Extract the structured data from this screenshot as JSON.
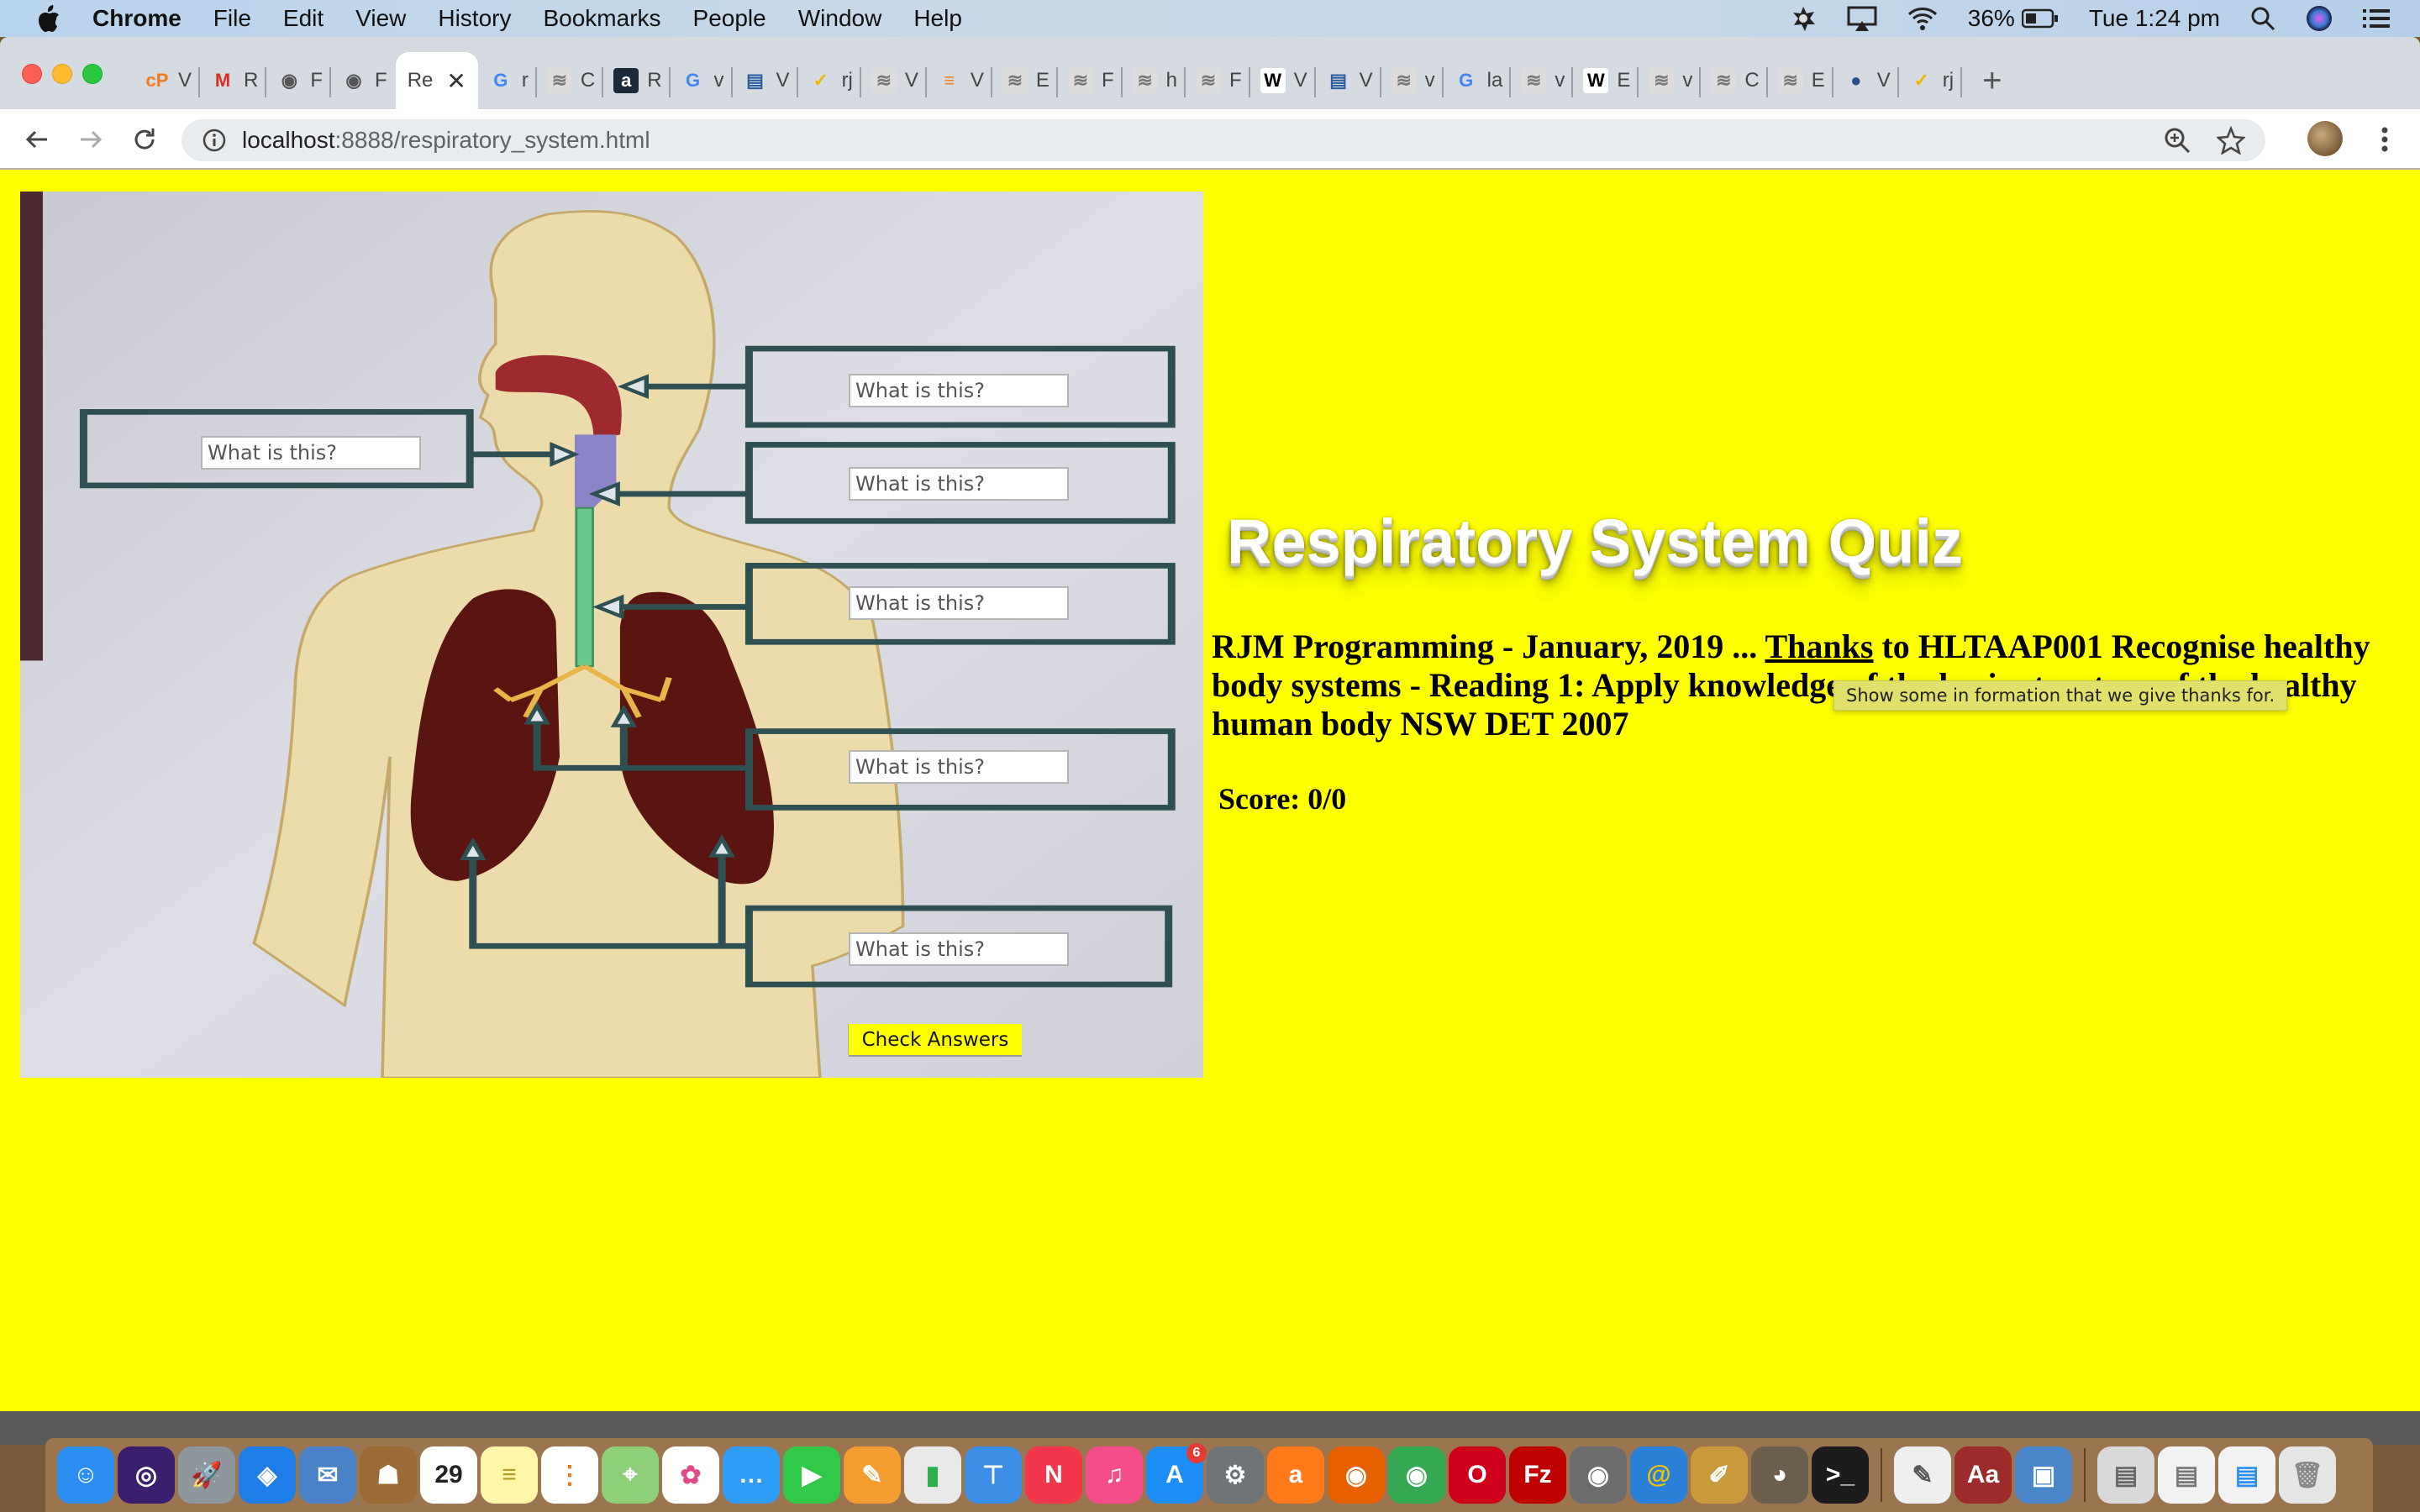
{
  "menubar": {
    "app_name": "Chrome",
    "items": [
      "File",
      "Edit",
      "View",
      "History",
      "Bookmarks",
      "People",
      "Window",
      "Help"
    ],
    "battery": "36%",
    "clock": "Tue 1:24 pm"
  },
  "tabs": [
    {
      "icon": "cpanel-icon",
      "glyph": "cP",
      "label": "V",
      "color": "#f07c1c",
      "bg": "transparent"
    },
    {
      "icon": "gmail-icon",
      "glyph": "M",
      "label": "R",
      "color": "#d93025",
      "bg": "transparent"
    },
    {
      "icon": "mamp-elephant-icon",
      "glyph": "◉",
      "label": "F",
      "color": "#555555",
      "bg": "transparent"
    },
    {
      "icon": "mamp-elephant-icon",
      "glyph": "◉",
      "label": "F",
      "color": "#555555",
      "bg": "transparent"
    },
    {
      "icon": "none",
      "glyph": "",
      "label": "Re",
      "active": true
    },
    {
      "icon": "google-icon",
      "glyph": "G",
      "label": "r",
      "color": "#4285f4",
      "bg": "transparent"
    },
    {
      "icon": "rjm-logo-icon",
      "glyph": "≋",
      "label": "C",
      "color": "#777777",
      "bg": "#dddddd"
    },
    {
      "icon": "amazon-icon",
      "glyph": "a",
      "label": "R",
      "color": "#ffffff",
      "bg": "#1b2a3a"
    },
    {
      "icon": "google-icon",
      "glyph": "G",
      "label": "v",
      "color": "#4285f4",
      "bg": "transparent"
    },
    {
      "icon": "document-icon",
      "glyph": "▤",
      "label": "V",
      "color": "#2a5d9f",
      "bg": "transparent"
    },
    {
      "icon": "norton-check-icon",
      "glyph": "✓",
      "label": "rj",
      "color": "#f2b600",
      "bg": "transparent"
    },
    {
      "icon": "rjm-logo-icon",
      "glyph": "≋",
      "label": "V",
      "color": "#777777",
      "bg": "#dddddd"
    },
    {
      "icon": "stackoverflow-icon",
      "glyph": "≡",
      "label": "V",
      "color": "#f48024",
      "bg": "transparent"
    },
    {
      "icon": "rjm-logo-icon",
      "glyph": "≋",
      "label": "E",
      "color": "#777777",
      "bg": "#dddddd"
    },
    {
      "icon": "rjm-logo-icon",
      "glyph": "≋",
      "label": "F",
      "color": "#777777",
      "bg": "#dddddd"
    },
    {
      "icon": "rjm-logo-icon",
      "glyph": "≋",
      "label": "h",
      "color": "#777777",
      "bg": "#dddddd"
    },
    {
      "icon": "rjm-logo-icon",
      "glyph": "≋",
      "label": "F",
      "color": "#777777",
      "bg": "#dddddd"
    },
    {
      "icon": "wikipedia-icon",
      "glyph": "W",
      "label": "V",
      "color": "#000000",
      "bg": "#ffffff"
    },
    {
      "icon": "document-icon",
      "glyph": "▤",
      "label": "V",
      "color": "#2a5d9f",
      "bg": "transparent"
    },
    {
      "icon": "rjm-logo-icon",
      "glyph": "≋",
      "label": "v",
      "color": "#777777",
      "bg": "#dddddd"
    },
    {
      "icon": "google-icon",
      "glyph": "G",
      "label": "la",
      "color": "#4285f4",
      "bg": "transparent"
    },
    {
      "icon": "rjm-logo-icon",
      "glyph": "≋",
      "label": "v",
      "color": "#777777",
      "bg": "#dddddd"
    },
    {
      "icon": "wikipedia-icon",
      "glyph": "W",
      "label": "E",
      "color": "#000000",
      "bg": "#ffffff"
    },
    {
      "icon": "rjm-logo-icon",
      "glyph": "≋",
      "label": "v",
      "color": "#777777",
      "bg": "#dddddd"
    },
    {
      "icon": "rjm-logo-icon",
      "glyph": "≋",
      "label": "C",
      "color": "#777777",
      "bg": "#dddddd"
    },
    {
      "icon": "rjm-logo-icon",
      "glyph": "≋",
      "label": "E",
      "color": "#777777",
      "bg": "#dddddd"
    },
    {
      "icon": "blue-orange-circle-icon",
      "glyph": "●",
      "label": "V",
      "color": "#2c4f8c",
      "bg": "transparent"
    },
    {
      "icon": "norton-check-icon",
      "glyph": "✓",
      "label": "rj",
      "color": "#f2b600",
      "bg": "transparent"
    }
  ],
  "toolbar": {
    "url_host": "localhost",
    "url_path": ":8888/respiratory_system.html"
  },
  "quiz": {
    "inputs": [
      {
        "placeholder": "What is this?",
        "value": ""
      },
      {
        "placeholder": "What is this?",
        "value": ""
      },
      {
        "placeholder": "What is this?",
        "value": ""
      },
      {
        "placeholder": "What is this?",
        "value": ""
      },
      {
        "placeholder": "What is this?",
        "value": ""
      },
      {
        "placeholder": "What is this?",
        "value": ""
      }
    ],
    "check_button": "Check Answers"
  },
  "page": {
    "title": "Respiratory System Quiz",
    "credits_before": " RJM Programming - January, 2019 ... ",
    "credits_link": "Thanks",
    "credits_after": " to HLTAAP001 Recognise healthy body systems - Reading 1: Apply knowledge of the basic structure of the healthy human body NSW DET 2007",
    "link_tooltip": "Show some in formation that we give thanks for.",
    "score_label": "Score: 0/0"
  },
  "dock": [
    {
      "name": "finder-icon",
      "glyph": "☺",
      "bg": "#2c8ef0"
    },
    {
      "name": "siri-icon",
      "glyph": "◎",
      "bg": "#3b1f6e"
    },
    {
      "name": "launchpad-icon",
      "glyph": "🚀",
      "bg": "#8e969e"
    },
    {
      "name": "safari-icon",
      "glyph": "◈",
      "bg": "#1e7de6"
    },
    {
      "name": "mail-icon",
      "glyph": "✉",
      "bg": "#4a82c8"
    },
    {
      "name": "contacts-icon",
      "glyph": "☗",
      "bg": "#9a6b36"
    },
    {
      "name": "calendar-icon",
      "glyph": "29",
      "bg": "#ffffff",
      "color": "#222"
    },
    {
      "name": "notes-icon",
      "glyph": "≡",
      "bg": "#fff6a8",
      "color": "#b39b2a"
    },
    {
      "name": "reminders-icon",
      "glyph": "⋮",
      "bg": "#ffffff",
      "color": "#e67e22"
    },
    {
      "name": "maps-icon",
      "glyph": "⌖",
      "bg": "#8fcf7a"
    },
    {
      "name": "photos-icon",
      "glyph": "✿",
      "bg": "#ffffff",
      "color": "#e04a8a"
    },
    {
      "name": "messages-icon",
      "glyph": "…",
      "bg": "#2f9cf5"
    },
    {
      "name": "facetime-icon",
      "glyph": "▶",
      "bg": "#31c94a"
    },
    {
      "name": "pages-icon",
      "glyph": "✎",
      "bg": "#f39c2f"
    },
    {
      "name": "numbers-icon",
      "glyph": "▮",
      "bg": "#e9e9e9",
      "color": "#2fae4f"
    },
    {
      "name": "keynote-icon",
      "glyph": "⊤",
      "bg": "#3c8ee6"
    },
    {
      "name": "news-icon",
      "glyph": "N",
      "bg": "#f4364c"
    },
    {
      "name": "itunes-icon",
      "glyph": "♫",
      "bg": "#f44d8a"
    },
    {
      "name": "app-store-icon",
      "glyph": "A",
      "bg": "#1e8cf5",
      "badge": "6"
    },
    {
      "name": "system-preferences-icon",
      "glyph": "⚙",
      "bg": "#6e7378"
    },
    {
      "name": "avast-icon",
      "glyph": "a",
      "bg": "#ff7a1a"
    },
    {
      "name": "firefox-icon",
      "glyph": "◉",
      "bg": "#e66000"
    },
    {
      "name": "chrome-icon",
      "glyph": "◉",
      "bg": "#34a853"
    },
    {
      "name": "opera-icon",
      "glyph": "O",
      "bg": "#d0021b"
    },
    {
      "name": "filezilla-icon",
      "glyph": "Fz",
      "bg": "#bf0000"
    },
    {
      "name": "mamp-icon",
      "glyph": "◉",
      "bg": "#6c6c6c"
    },
    {
      "name": "cyberduck-icon",
      "glyph": "@",
      "bg": "#2a7fd6",
      "color": "#f5c400"
    },
    {
      "name": "paint-brush-icon",
      "glyph": "✐",
      "bg": "#c99a3a"
    },
    {
      "name": "gimp-icon",
      "glyph": "◕",
      "bg": "#6d5f4e"
    },
    {
      "name": "terminal-icon",
      "glyph": ">_",
      "bg": "#1c1c1c"
    },
    {
      "sep": true
    },
    {
      "name": "script-editor-icon",
      "glyph": "✎",
      "bg": "#eeeeee",
      "color": "#555"
    },
    {
      "name": "dictionary-icon",
      "glyph": "Aa",
      "bg": "#9d2b2b"
    },
    {
      "name": "preview-icon",
      "glyph": "▣",
      "bg": "#4b87c8"
    },
    {
      "sep": true
    },
    {
      "name": "downloads-stack-icon",
      "glyph": "▤",
      "bg": "#d9d9d9",
      "color": "#666"
    },
    {
      "name": "documents-stack-icon",
      "glyph": "▤",
      "bg": "#f2f2f2",
      "color": "#777"
    },
    {
      "name": "finder-window-stack-icon",
      "glyph": "▤",
      "bg": "#f2f2f2",
      "color": "#2c8ef0"
    },
    {
      "name": "trash-icon",
      "glyph": "🗑",
      "bg": "#e5e5e5",
      "color": "#888"
    }
  ]
}
